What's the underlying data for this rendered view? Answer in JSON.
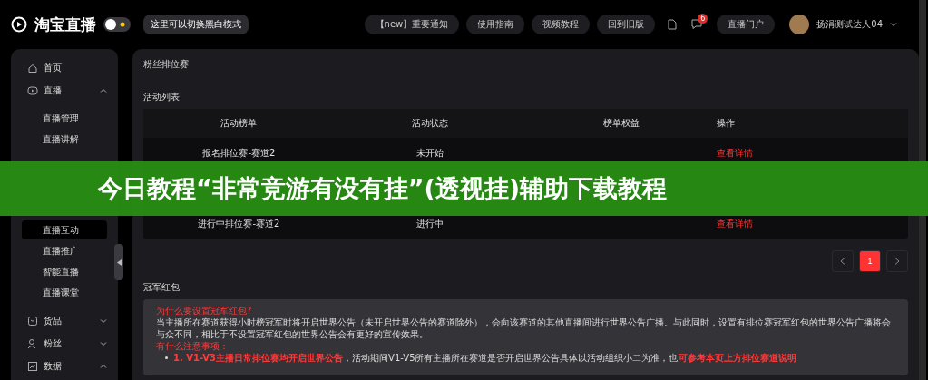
{
  "header": {
    "logo_text": "淘宝直播",
    "theme_toggle": {
      "on": false
    },
    "tooltip": "这里可以切换黑白模式",
    "links": [
      "【new】重要通知",
      "使用指南",
      "视频教程",
      "回到旧版"
    ],
    "message_badge": "6",
    "portal_button": "直播门户",
    "user_name": "扬涓测试达人04"
  },
  "sidebar": {
    "items": [
      {
        "label": "首页",
        "kind": "home"
      },
      {
        "label": "直播",
        "kind": "live",
        "expanded": true,
        "children": [
          {
            "label": "直播管理",
            "selected": false
          },
          {
            "label": "直播讲解",
            "selected": false
          },
          {
            "kind": "hidden"
          },
          {
            "label": "直播互动",
            "selected": true
          },
          {
            "label": "直播推广",
            "selected": false
          },
          {
            "label": "智能直播",
            "selected": false
          },
          {
            "label": "直播课堂",
            "selected": false
          }
        ]
      },
      {
        "label": "货品",
        "kind": "goods",
        "expanded": false
      },
      {
        "label": "粉丝",
        "kind": "fans",
        "expanded": false
      },
      {
        "label": "数据",
        "kind": "data",
        "expanded": true
      }
    ]
  },
  "panel": {
    "title": "粉丝排位赛",
    "table_title": "活动列表",
    "table": {
      "columns": [
        "活动榜单",
        "活动状态",
        "榜单权益",
        "操作"
      ],
      "rows": [
        {
          "name": "报名排位赛-赛道2",
          "status": "未开始",
          "benefit": "",
          "action": "查看详情"
        },
        {
          "kind": "covered"
        },
        {
          "name": "进行中排位赛-赛道2",
          "status": "进行中",
          "benefit": "",
          "action": "查看详情"
        }
      ]
    },
    "pagination": {
      "pages": [
        {
          "label": "1",
          "selected": true
        }
      ]
    },
    "section_title": "冠军红包",
    "notice": [
      {
        "kind": "heading",
        "text": "为什么要设置冠军红包?"
      },
      {
        "kind": "para",
        "text": "当主播所在赛道获得小时榜冠军时将开启世界公告（未开启世界公告的赛道除外），会向该赛道的其他直播间进行世界公告广播。与此同时，设置有排位赛冠军红包的世界公告广播将会与众不同，相比于不设置冠军红包的世界公告会有更好的宣传效果。"
      },
      {
        "kind": "heading",
        "text": "有什么注意事项："
      },
      {
        "kind": "bullet",
        "text": "**1. V1-V3主播日常排位赛均开启世界公告**，活动期间V1-V5所有主播所在赛道是否开启世界公告具体以活动组织小二为准，也**可参考本页上方排位赛道说明**"
      }
    ]
  },
  "banner": "今日教程“非常竞游有没有挂”(透视挂)辅助下载教程"
}
